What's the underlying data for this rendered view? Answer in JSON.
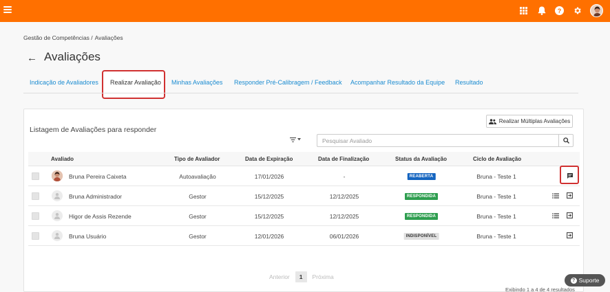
{
  "topbar": {
    "icons": [
      "menu-icon",
      "apps-grid-icon",
      "bell-icon",
      "help-icon",
      "gear-icon",
      "user-avatar"
    ]
  },
  "breadcrumb": [
    "Gestão de Competências /",
    "Avaliações"
  ],
  "page_title": "Avaliações",
  "tabs": [
    {
      "label": "Indicação de Avaliadores",
      "active": false
    },
    {
      "label": "Realizar Avaliação",
      "active": true
    },
    {
      "label": "Minhas Avaliações",
      "active": false
    },
    {
      "label": "Responder Pré-Calibragem / Feedback",
      "active": false
    },
    {
      "label": "Acompanhar Resultado da Equipe",
      "active": false
    },
    {
      "label": "Resultado",
      "active": false
    }
  ],
  "list_title": "Listagem de Avaliações para responder",
  "multi_button_label": "Realizar Múltiplas Avaliações",
  "search": {
    "placeholder": "Pesquisar Avaliado",
    "value": ""
  },
  "table": {
    "headers": [
      "Avaliado",
      "Tipo de Avaliador",
      "Data de Expiração",
      "Data de Finalização",
      "Status da Avaliação",
      "Ciclo de Avaliação"
    ],
    "rows": [
      {
        "name": "Bruna Pereira Caixeta",
        "tipo": "Autoavaliação",
        "expiracao": "17/01/2026",
        "finalizacao": "-",
        "status": "REABERTA",
        "ciclo": "Bruna - Teste 1"
      },
      {
        "name": "Bruna Administrador",
        "tipo": "Gestor",
        "expiracao": "15/12/2025",
        "finalizacao": "12/12/2025",
        "status": "RESPONDIDA",
        "ciclo": "Bruna - Teste 1"
      },
      {
        "name": "Higor de Assis Rezende",
        "tipo": "Gestor",
        "expiracao": "15/12/2025",
        "finalizacao": "12/12/2025",
        "status": "RESPONDIDA",
        "ciclo": "Bruna - Teste 1"
      },
      {
        "name": "Bruna Usuário",
        "tipo": "Gestor",
        "expiracao": "12/01/2026",
        "finalizacao": "06/01/2026",
        "status": "INDISPONÍVEL",
        "ciclo": "Bruna - Teste 1"
      }
    ]
  },
  "status_colors": {
    "REABERTA": "#1565c0",
    "RESPONDIDA": "#2e9e4f",
    "INDISPONÍVEL": "#e0e0e0"
  },
  "pagination": {
    "prev": "Anterior",
    "current": "1",
    "next": "Próxima"
  },
  "showing_text": "Exibindo 1 a 4 de 4 resultados",
  "support_label": "Suporte",
  "accent_color": "#ff7000",
  "highlight_color": "#d03030"
}
